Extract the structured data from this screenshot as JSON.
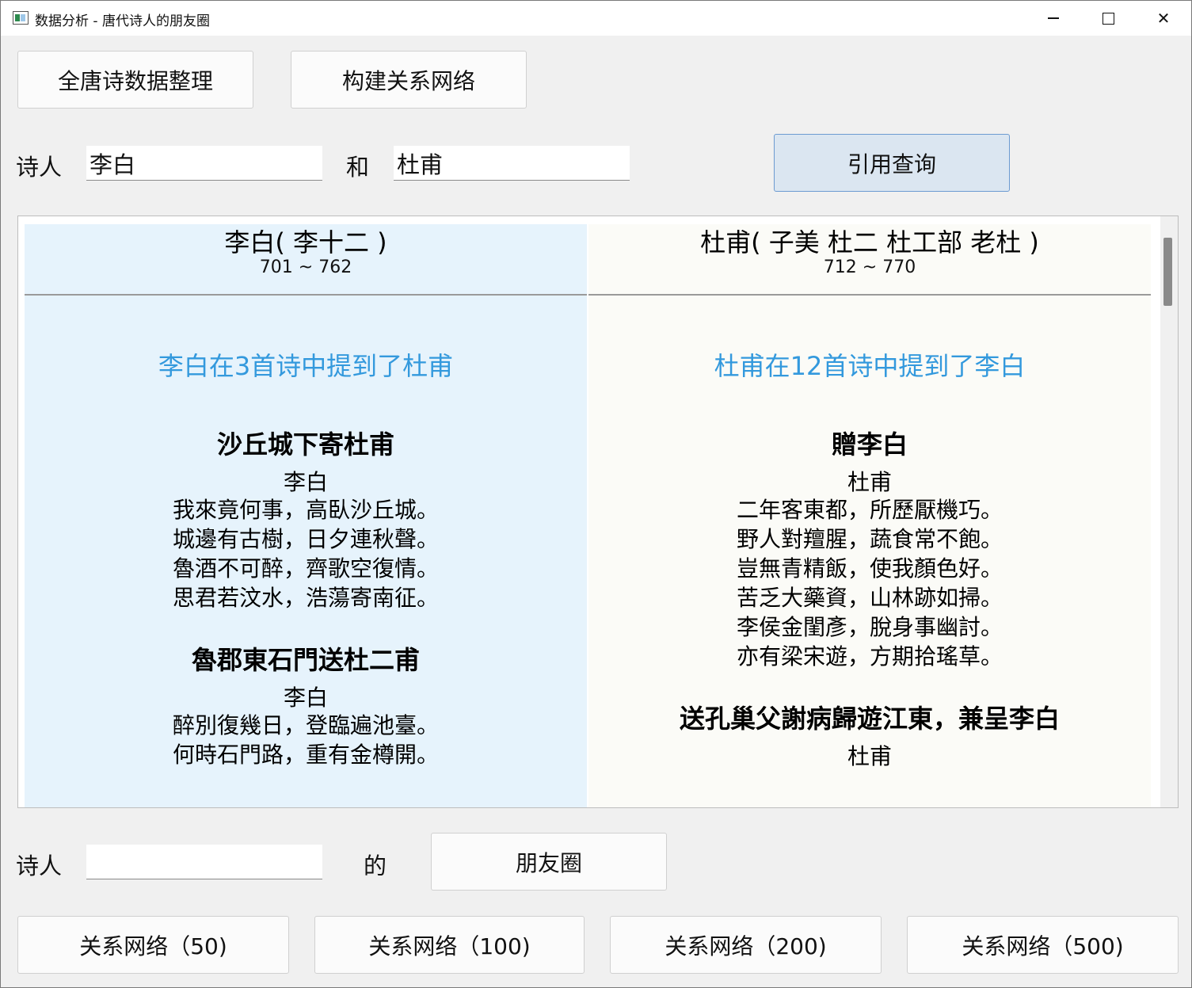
{
  "window": {
    "title": "数据分析 - 唐代诗人的朋友圈",
    "min_glyph": "",
    "close_glyph": "✕"
  },
  "toolbar": {
    "collect_button": "全唐诗数据整理",
    "network_button": "构建关系网络"
  },
  "query": {
    "poet_label": "诗人",
    "poet_a": "李白",
    "and_label": "和",
    "poet_b": "杜甫",
    "search_button": "引用查询"
  },
  "results": {
    "left": {
      "name": "李白( 李十二 )",
      "years": "701 ~ 762",
      "count_text": "李白在3首诗中提到了杜甫",
      "poems": [
        {
          "title": "沙丘城下寄杜甫",
          "author": "李白",
          "lines": [
            "我來竟何事，高臥沙丘城。",
            "城邊有古樹，日夕連秋聲。",
            "魯酒不可醉，齊歌空復情。",
            "思君若汶水，浩蕩寄南征。"
          ]
        },
        {
          "title": "魯郡東石門送杜二甫",
          "author": "李白",
          "lines": [
            "醉別復幾日，登臨遍池臺。",
            "何時石門路，重有金樽開。"
          ]
        }
      ]
    },
    "right": {
      "name": "杜甫( 子美 杜二 杜工部 老杜 )",
      "years": "712 ~ 770",
      "count_text": "杜甫在12首诗中提到了李白",
      "poems": [
        {
          "title": "贈李白",
          "author": "杜甫",
          "lines": [
            "二年客東都，所歷厭機巧。",
            "野人對羶腥，蔬食常不飽。",
            "豈無青精飯，使我顏色好。",
            "苦乏大藥資，山林跡如掃。",
            "李侯金閨彥，脫身事幽討。",
            "亦有梁宋遊，方期拾瑤草。"
          ]
        },
        {
          "title": "送孔巢父謝病歸遊江東，兼呈李白",
          "author": "杜甫",
          "lines": []
        }
      ]
    }
  },
  "friends": {
    "poet_label": "诗人",
    "poet_value": "",
    "of_label": "的",
    "friends_button": "朋友圈"
  },
  "network_buttons": [
    "关系网络（50)",
    "关系网络（100)",
    "关系网络（200)",
    "关系网络（500)"
  ]
}
